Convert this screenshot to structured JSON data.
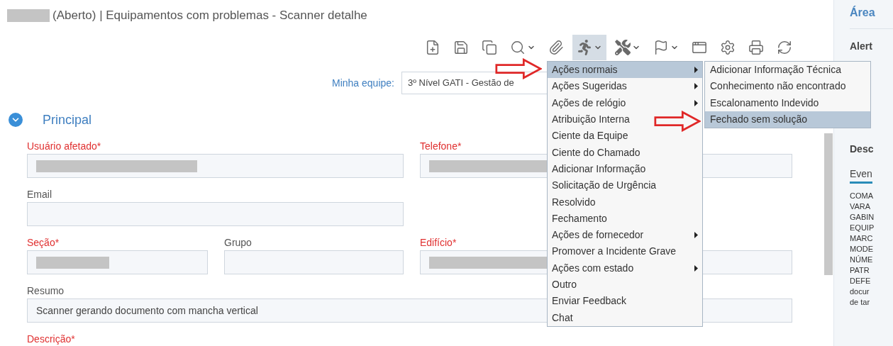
{
  "title": {
    "text": "(Aberto) | Equipamentos com problemas - Scanner detalhe",
    "redacted_prefix": true
  },
  "toolbar": [
    {
      "kind": "new",
      "dropdown": false,
      "active": false
    },
    {
      "kind": "save",
      "dropdown": false,
      "active": false
    },
    {
      "kind": "copy",
      "dropdown": false,
      "active": false
    },
    {
      "kind": "search",
      "dropdown": true,
      "active": false
    },
    {
      "kind": "attach",
      "dropdown": false,
      "active": false
    },
    {
      "kind": "actions",
      "dropdown": true,
      "active": true
    },
    {
      "kind": "tools",
      "dropdown": true,
      "active": false
    },
    {
      "kind": "flag",
      "dropdown": true,
      "active": false
    },
    {
      "kind": "window",
      "dropdown": false,
      "active": false
    },
    {
      "kind": "settings",
      "dropdown": false,
      "active": false
    },
    {
      "kind": "print",
      "dropdown": false,
      "active": false
    },
    {
      "kind": "refresh",
      "dropdown": false,
      "active": false
    }
  ],
  "team": {
    "label": "Minha equipe:",
    "value": "3º Nível GATI - Gestão de"
  },
  "section": {
    "title": "Principal",
    "expanded": true
  },
  "fields": [
    {
      "label": "Usuário afetado*",
      "required": true,
      "redacted": true
    },
    {
      "label": "Telefone*",
      "required": true,
      "redacted": true
    },
    {
      "label": "Email",
      "required": false,
      "redacted": false
    },
    {
      "label": "Seção*",
      "required": true,
      "redacted": true
    },
    {
      "label": "Grupo",
      "required": false,
      "redacted": false
    },
    {
      "label": "Edifício*",
      "required": true,
      "redacted": true
    },
    {
      "label": "Resumo",
      "required": false,
      "redacted": false,
      "value": "Scanner gerando documento com mancha vertical"
    },
    {
      "label": "Descrição*",
      "required": true
    }
  ],
  "menu": [
    {
      "label": "Ações normais",
      "selected": true,
      "submenu": true
    },
    {
      "label": "Ações Sugeridas",
      "selected": false,
      "submenu": true
    },
    {
      "label": "Ações de relógio",
      "selected": false,
      "submenu": true
    },
    {
      "label": "Atribuição Interna",
      "selected": false,
      "submenu": false
    },
    {
      "label": "Ciente da Equipe",
      "selected": false,
      "submenu": false
    },
    {
      "label": "Ciente do Chamado",
      "selected": false,
      "submenu": false
    },
    {
      "label": "Adicionar Informação",
      "selected": false,
      "submenu": false
    },
    {
      "label": "Solicitação de Urgência",
      "selected": false,
      "submenu": false
    },
    {
      "label": "Resolvido",
      "selected": false,
      "submenu": false
    },
    {
      "label": "Fechamento",
      "selected": false,
      "submenu": false
    },
    {
      "label": "Ações de fornecedor",
      "selected": false,
      "submenu": true
    },
    {
      "label": "Promover a Incidente Grave",
      "selected": false,
      "submenu": false
    },
    {
      "label": "Ações com estado",
      "selected": false,
      "submenu": true
    },
    {
      "label": "Outro",
      "selected": false,
      "submenu": false
    },
    {
      "label": "Enviar Feedback",
      "selected": false,
      "submenu": false
    },
    {
      "label": "Chat",
      "selected": false,
      "submenu": false
    }
  ],
  "submenu": [
    {
      "label": "Adicionar Informação Técnica",
      "selected": false
    },
    {
      "label": "Conhecimento não encontrado",
      "selected": false
    },
    {
      "label": "Escalonamento Indevido",
      "selected": false
    },
    {
      "label": "Fechado sem solução",
      "selected": true
    }
  ],
  "side_panel": {
    "title": "Área",
    "alert": "Alert",
    "description": "Desc",
    "tab": "Even",
    "lines": [
      "COMA",
      "VARA",
      "GABIN",
      "EQUIP",
      "MARC",
      "MODE",
      "NÚME",
      "PATR",
      "DEFE",
      "docur",
      "de tar"
    ]
  }
}
